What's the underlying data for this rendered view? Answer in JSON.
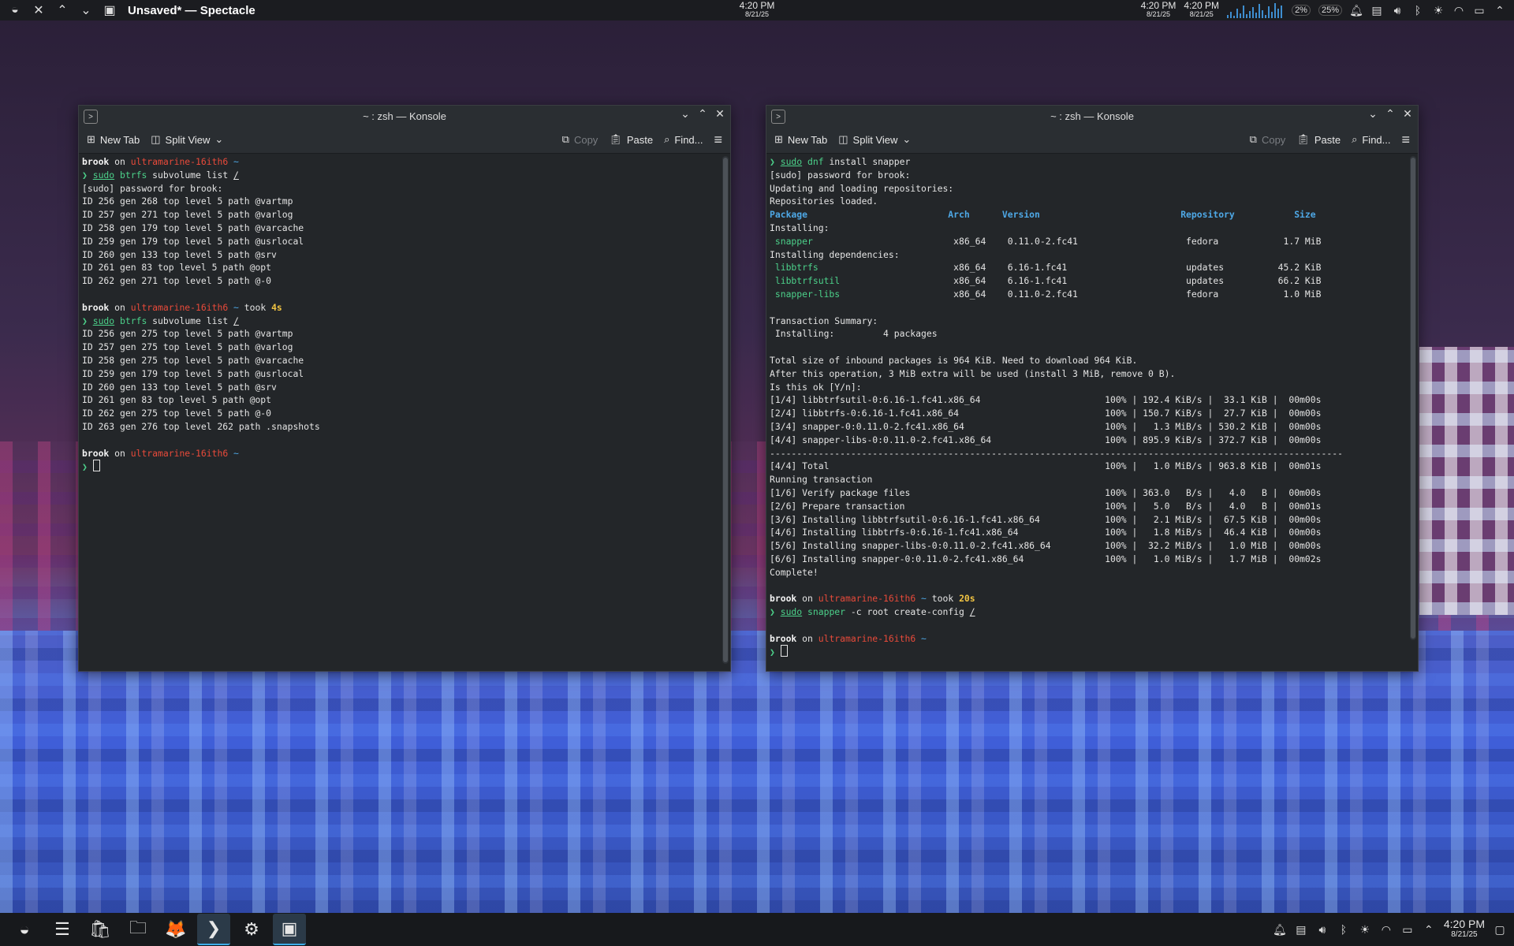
{
  "topbar": {
    "title": "Unsaved* — Spectacle",
    "clock_time": "4:20 PM",
    "clock_date": "8/21/25",
    "mini_clocks": [
      {
        "time": "4:20 PM",
        "date": "8/21/25"
      },
      {
        "time": "4:20 PM",
        "date": "8/21/25"
      }
    ],
    "cpu_percent": "2%",
    "mem_percent": "25%"
  },
  "window_left": {
    "title": "~ : zsh — Konsole",
    "toolbar": {
      "new_tab": "New Tab",
      "split_view": "Split View",
      "copy": "Copy",
      "paste": "Paste",
      "find": "Find..."
    },
    "lines": [
      {
        "t": ""
      },
      {
        "t": "prompt",
        "user": "brook",
        "on": " on ",
        "host": "ultramarine-16ith6",
        "dir": " ~",
        "took": ""
      },
      {
        "t": "cmd",
        "parts": [
          [
            "arrow",
            "❯ "
          ],
          [
            "sudo",
            "sudo"
          ],
          [
            "txt",
            " "
          ],
          [
            "cmd",
            "btrfs"
          ],
          [
            "txt",
            " subvolume list "
          ],
          [
            "u",
            "/"
          ]
        ]
      },
      {
        "t": "text",
        "v": "[sudo] password for brook:"
      },
      {
        "t": "text",
        "v": "ID 256 gen 268 top level 5 path @vartmp"
      },
      {
        "t": "text",
        "v": "ID 257 gen 271 top level 5 path @varlog"
      },
      {
        "t": "text",
        "v": "ID 258 gen 179 top level 5 path @varcache"
      },
      {
        "t": "text",
        "v": "ID 259 gen 179 top level 5 path @usrlocal"
      },
      {
        "t": "text",
        "v": "ID 260 gen 133 top level 5 path @srv"
      },
      {
        "t": "text",
        "v": "ID 261 gen 83 top level 5 path @opt"
      },
      {
        "t": "text",
        "v": "ID 262 gen 271 top level 5 path @-0"
      },
      {
        "t": "text",
        "v": ""
      },
      {
        "t": "prompt",
        "user": "brook",
        "on": " on ",
        "host": "ultramarine-16ith6",
        "dir": " ~",
        "tooklabel": " took ",
        "took": "4s"
      },
      {
        "t": "cmd",
        "parts": [
          [
            "arrow",
            "❯ "
          ],
          [
            "sudo",
            "sudo"
          ],
          [
            "txt",
            " "
          ],
          [
            "cmd",
            "btrfs"
          ],
          [
            "txt",
            " subvolume list "
          ],
          [
            "u",
            "/"
          ]
        ]
      },
      {
        "t": "text",
        "v": "ID 256 gen 275 top level 5 path @vartmp"
      },
      {
        "t": "text",
        "v": "ID 257 gen 275 top level 5 path @varlog"
      },
      {
        "t": "text",
        "v": "ID 258 gen 275 top level 5 path @varcache"
      },
      {
        "t": "text",
        "v": "ID 259 gen 179 top level 5 path @usrlocal"
      },
      {
        "t": "text",
        "v": "ID 260 gen 133 top level 5 path @srv"
      },
      {
        "t": "text",
        "v": "ID 261 gen 83 top level 5 path @opt"
      },
      {
        "t": "text",
        "v": "ID 262 gen 275 top level 5 path @-0"
      },
      {
        "t": "text",
        "v": "ID 263 gen 276 top level 262 path .snapshots"
      },
      {
        "t": "text",
        "v": ""
      },
      {
        "t": "prompt",
        "user": "brook",
        "on": " on ",
        "host": "ultramarine-16ith6",
        "dir": " ~",
        "took": ""
      },
      {
        "t": "cursor"
      }
    ]
  },
  "window_right": {
    "title": "~ : zsh — Konsole",
    "toolbar": {
      "new_tab": "New Tab",
      "split_view": "Split View",
      "copy": "Copy",
      "paste": "Paste",
      "find": "Find..."
    },
    "lines": [
      {
        "t": "cmd",
        "parts": [
          [
            "arrow",
            "❯ "
          ],
          [
            "sudo",
            "sudo"
          ],
          [
            "txt",
            " "
          ],
          [
            "cmd",
            "dnf"
          ],
          [
            "txt",
            " install snapper"
          ]
        ]
      },
      {
        "t": "text",
        "v": "[sudo] password for brook:"
      },
      {
        "t": "text",
        "v": "Updating and loading repositories:"
      },
      {
        "t": "text",
        "v": "Repositories loaded."
      },
      {
        "t": "hdr",
        "v": "Package                          Arch      Version                          Repository           Size"
      },
      {
        "t": "text",
        "v": "Installing:"
      },
      {
        "t": "pkgrow",
        "name": " snapper",
        "rest": "                          x86_64    0.11.0-2.fc41                    fedora            1.7 MiB"
      },
      {
        "t": "text",
        "v": "Installing dependencies:"
      },
      {
        "t": "pkgrow",
        "name": " libbtrfs",
        "rest": "                         x86_64    6.16-1.fc41                      updates          45.2 KiB"
      },
      {
        "t": "pkgrow",
        "name": " libbtrfsutil",
        "rest": "                     x86_64    6.16-1.fc41                      updates          66.2 KiB"
      },
      {
        "t": "pkgrow",
        "name": " snapper-libs",
        "rest": "                     x86_64    0.11.0-2.fc41                    fedora            1.0 MiB"
      },
      {
        "t": "text",
        "v": ""
      },
      {
        "t": "text",
        "v": "Transaction Summary:"
      },
      {
        "t": "text",
        "v": " Installing:         4 packages"
      },
      {
        "t": "text",
        "v": ""
      },
      {
        "t": "text",
        "v": "Total size of inbound packages is 964 KiB. Need to download 964 KiB."
      },
      {
        "t": "text",
        "v": "After this operation, 3 MiB extra will be used (install 3 MiB, remove 0 B)."
      },
      {
        "t": "text",
        "v": "Is this ok [Y/n]:"
      },
      {
        "t": "text",
        "v": "[1/4] libbtrfsutil-0:6.16-1.fc41.x86_64                       100% | 192.4 KiB/s |  33.1 KiB |  00m00s"
      },
      {
        "t": "text",
        "v": "[2/4] libbtrfs-0:6.16-1.fc41.x86_64                           100% | 150.7 KiB/s |  27.7 KiB |  00m00s"
      },
      {
        "t": "text",
        "v": "[3/4] snapper-0:0.11.0-2.fc41.x86_64                          100% |   1.3 MiB/s | 530.2 KiB |  00m00s"
      },
      {
        "t": "text",
        "v": "[4/4] snapper-libs-0:0.11.0-2.fc41.x86_64                     100% | 895.9 KiB/s | 372.7 KiB |  00m00s"
      },
      {
        "t": "text",
        "v": "----------------------------------------------------------------------------------------------------------"
      },
      {
        "t": "text",
        "v": "[4/4] Total                                                   100% |   1.0 MiB/s | 963.8 KiB |  00m01s"
      },
      {
        "t": "text",
        "v": "Running transaction"
      },
      {
        "t": "text",
        "v": "[1/6] Verify package files                                    100% | 363.0   B/s |   4.0   B |  00m00s"
      },
      {
        "t": "text",
        "v": "[2/6] Prepare transaction                                     100% |   5.0   B/s |   4.0   B |  00m01s"
      },
      {
        "t": "text",
        "v": "[3/6] Installing libbtrfsutil-0:6.16-1.fc41.x86_64            100% |   2.1 MiB/s |  67.5 KiB |  00m00s"
      },
      {
        "t": "text",
        "v": "[4/6] Installing libbtrfs-0:6.16-1.fc41.x86_64                100% |   1.8 MiB/s |  46.4 KiB |  00m00s"
      },
      {
        "t": "text",
        "v": "[5/6] Installing snapper-libs-0:0.11.0-2.fc41.x86_64          100% |  32.2 MiB/s |   1.0 MiB |  00m00s"
      },
      {
        "t": "text",
        "v": "[6/6] Installing snapper-0:0.11.0-2.fc41.x86_64               100% |   1.0 MiB/s |   1.7 MiB |  00m02s"
      },
      {
        "t": "text",
        "v": "Complete!"
      },
      {
        "t": "text",
        "v": ""
      },
      {
        "t": "prompt",
        "user": "brook",
        "on": " on ",
        "host": "ultramarine-16ith6",
        "dir": " ~",
        "tooklabel": " took ",
        "took": "20s"
      },
      {
        "t": "cmd",
        "parts": [
          [
            "arrow",
            "❯ "
          ],
          [
            "sudo",
            "sudo"
          ],
          [
            "txt",
            " "
          ],
          [
            "cmd",
            "snapper"
          ],
          [
            "txt",
            " -c root create-config "
          ],
          [
            "u",
            "/"
          ]
        ]
      },
      {
        "t": "text",
        "v": ""
      },
      {
        "t": "prompt",
        "user": "brook",
        "on": " on ",
        "host": "ultramarine-16ith6",
        "dir": " ~",
        "took": ""
      },
      {
        "t": "cursor"
      }
    ]
  },
  "taskbar": {
    "apps": [
      {
        "name": "app-launcher",
        "icon": "ultramarine-logo-icon",
        "glyph": "◒"
      },
      {
        "name": "system-settings-switcher",
        "icon": "sliders-icon",
        "glyph": "☰"
      },
      {
        "name": "discover-store",
        "icon": "store-bag-icon",
        "glyph": "🛍"
      },
      {
        "name": "dolphin-file-manager",
        "icon": "folder-icon",
        "glyph": "🗀"
      },
      {
        "name": "firefox",
        "icon": "firefox-icon",
        "glyph": "🦊"
      },
      {
        "name": "konsole",
        "icon": "terminal-icon",
        "glyph": "❯"
      },
      {
        "name": "system-settings",
        "icon": "gear-icon",
        "glyph": "⚙"
      },
      {
        "name": "spectacle",
        "icon": "screenshot-icon",
        "glyph": "▣"
      }
    ],
    "clock_time": "4:20 PM",
    "clock_date": "8/21/25"
  }
}
